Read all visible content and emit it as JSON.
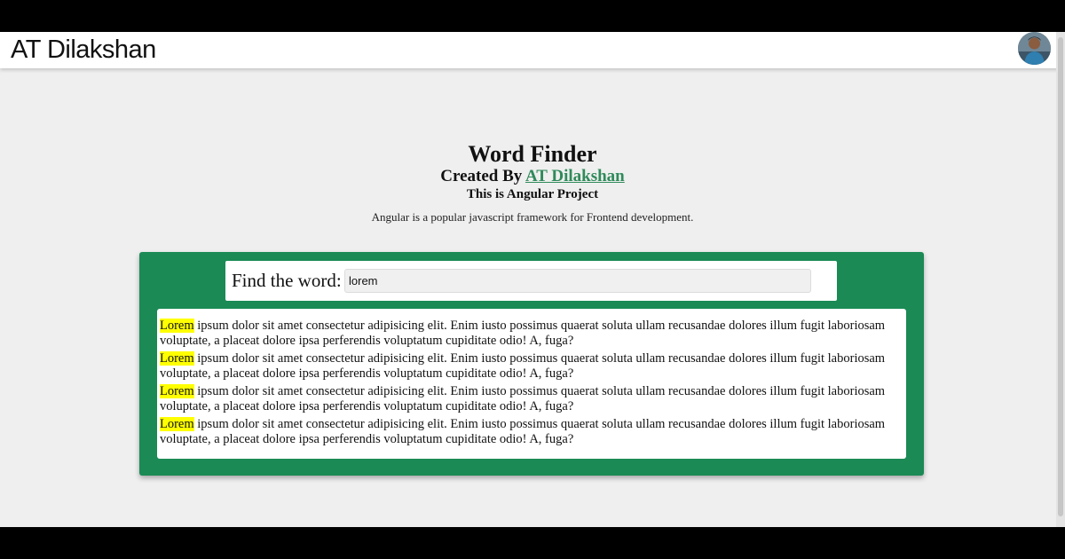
{
  "header": {
    "brand": "AT Dilakshan"
  },
  "main": {
    "title": "Word Finder",
    "created_prefix": "Created By",
    "created_link": "AT Dilakshan",
    "subtitle": "This is Angular Project",
    "description": "Angular is a popular javascript framework for Frontend development."
  },
  "finder": {
    "label": "Find the word:",
    "value": "lorem"
  },
  "results": [
    {
      "highlight": "Lorem",
      "rest": " ipsum dolor sit amet consectetur adipisicing elit. Enim iusto possimus quaerat soluta ullam recusandae dolores illum fugit laboriosam voluptate, a placeat dolore ipsa perferendis voluptatum cupiditate odio! A, fuga?"
    },
    {
      "highlight": "Lorem",
      "rest": " ipsum dolor sit amet consectetur adipisicing elit. Enim iusto possimus quaerat soluta ullam recusandae dolores illum fugit laboriosam voluptate, a placeat dolore ipsa perferendis voluptatum cupiditate odio! A, fuga?"
    },
    {
      "highlight": "Lorem",
      "rest": " ipsum dolor sit amet consectetur adipisicing elit. Enim iusto possimus quaerat soluta ullam recusandae dolores illum fugit laboriosam voluptate, a placeat dolore ipsa perferendis voluptatum cupiditate odio! A, fuga?"
    },
    {
      "highlight": "Lorem",
      "rest": " ipsum dolor sit amet consectetur adipisicing elit. Enim iusto possimus quaerat soluta ullam recusandae dolores illum fugit laboriosam voluptate, a placeat dolore ipsa perferendis voluptatum cupiditate odio! A, fuga?"
    }
  ],
  "colors": {
    "card_green": "#1b8a55",
    "link_green": "#2f8a5a",
    "highlight": "#ffff00",
    "page_bg": "#efefef"
  },
  "icons": {
    "avatar": "user-avatar-photo"
  }
}
